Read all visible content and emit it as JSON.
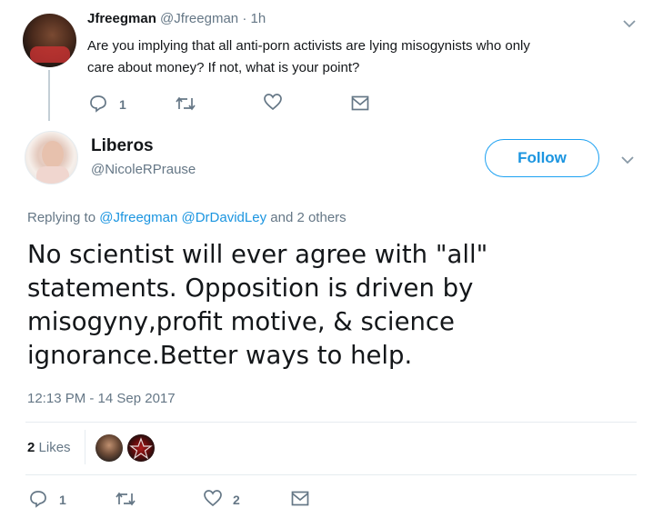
{
  "reply": {
    "name": "Jfreegman",
    "handle": "@Jfreegman",
    "sep": "·",
    "time": "1h",
    "text_line1": "Are you implying that all anti-porn activists are lying misogynists who only",
    "text_line2": "care about money? If not, what is your point?",
    "reply_count": "1"
  },
  "tweet": {
    "name": "Liberos",
    "handle": "@NicoleRPrause",
    "follow_label": "Follow",
    "replying_prefix": "Replying to",
    "replying_users": [
      "@Jfreegman",
      "@DrDavidLey"
    ],
    "replying_suffix": "and 2 others",
    "text_lines": [
      "No scientist will ever agree with \"all\"",
      "statements. Opposition is driven by",
      "misogyny,profit motive, & science",
      "ignorance.Better ways to help."
    ],
    "timestamp": "12:13 PM - 14 Sep 2017",
    "likes_count": "2",
    "likes_label": "Likes",
    "reply_count": "1",
    "like_count": "2"
  },
  "colors": {
    "link": "#1b95e0",
    "muted": "#657786",
    "divider": "#e6ecf0"
  },
  "icons": [
    "reply-icon",
    "retweet-icon",
    "like-icon",
    "message-icon",
    "chevron-down-icon"
  ]
}
